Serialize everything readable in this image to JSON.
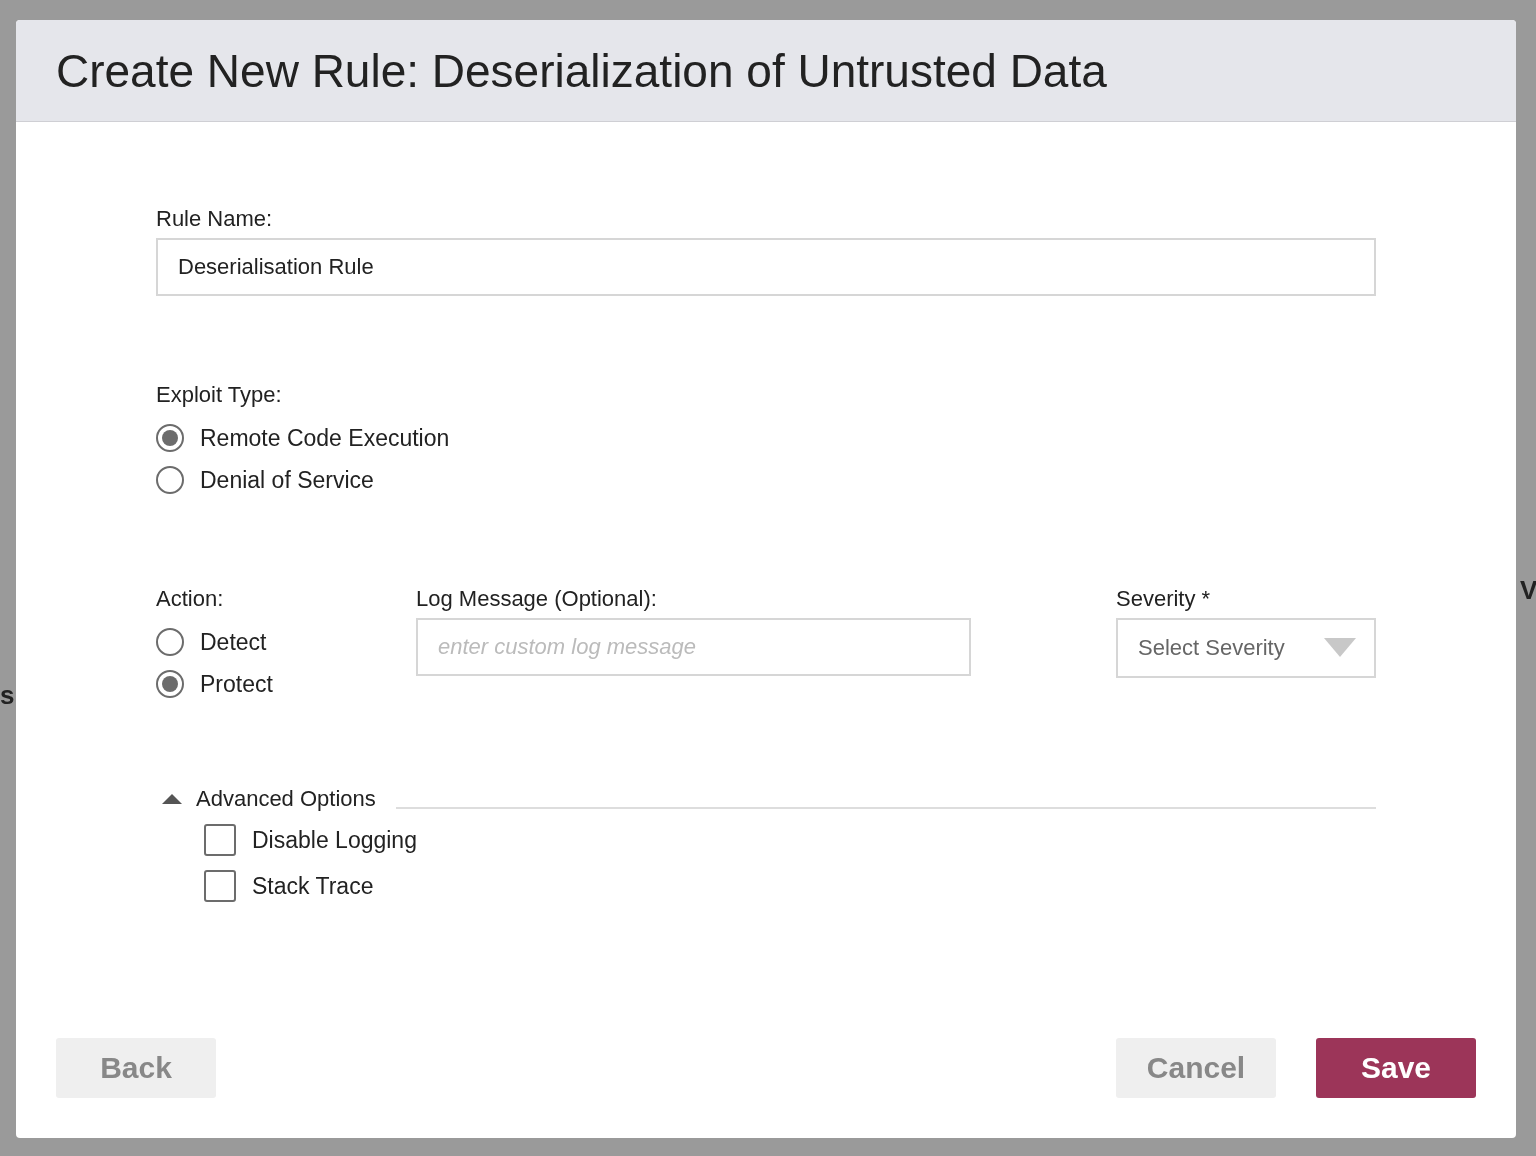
{
  "background": {
    "left_text": "s",
    "right_text": "V"
  },
  "dialog": {
    "title": "Create New Rule: Deserialization of Untrusted Data",
    "rule_name": {
      "label": "Rule Name:",
      "value": "Deserialisation Rule"
    },
    "exploit_type": {
      "label": "Exploit Type:",
      "options": [
        {
          "label": "Remote Code Execution",
          "selected": true
        },
        {
          "label": "Denial of Service",
          "selected": false
        }
      ]
    },
    "action": {
      "label": "Action:",
      "options": [
        {
          "label": "Detect",
          "selected": false
        },
        {
          "label": "Protect",
          "selected": true
        }
      ]
    },
    "log_message": {
      "label": "Log Message (Optional):",
      "placeholder": "enter custom log message"
    },
    "severity": {
      "label": "Severity *",
      "placeholder": "Select Severity"
    },
    "advanced": {
      "label": "Advanced Options",
      "expanded": true,
      "options": [
        {
          "label": "Disable Logging",
          "checked": false
        },
        {
          "label": "Stack Trace",
          "checked": false
        }
      ]
    },
    "buttons": [
      {
        "label": "Back",
        "kind": "secondary"
      },
      {
        "label": "Cancel",
        "kind": "secondary"
      },
      {
        "label": "Save",
        "kind": "primary"
      }
    ]
  }
}
